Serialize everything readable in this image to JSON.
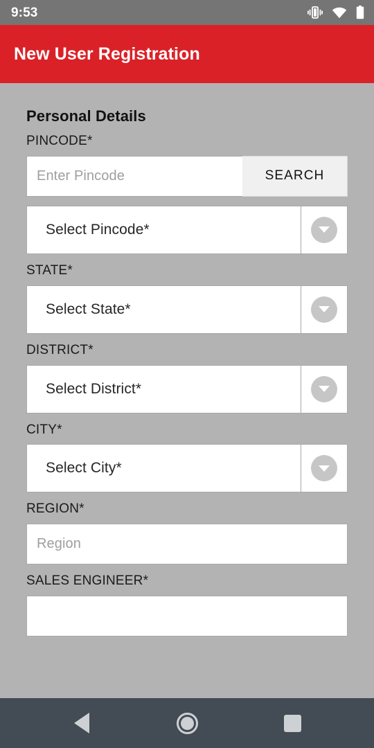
{
  "status_bar": {
    "time": "9:53",
    "icons": [
      "vibrate-icon",
      "wifi-icon",
      "battery-icon"
    ]
  },
  "app_bar": {
    "title": "New User Registration",
    "background_color": "#da2128",
    "text_color": "#ffffff"
  },
  "theme": {
    "page_background": "#b3b3b3",
    "field_background": "#ffffff",
    "field_border": "#a8a8a8",
    "status_bar_background": "#757575",
    "nav_bar_background": "#434b54",
    "nav_icon_color": "#cdd1d4",
    "dropdown_circle_color": "#c6c6c6",
    "search_button_background": "#f0f0f0",
    "placeholder_color": "#9e9e9e"
  },
  "form": {
    "section_title": "Personal Details",
    "fields": [
      {
        "key": "pincode",
        "label": "PINCODE*",
        "type": "text-with-button",
        "placeholder": "Enter Pincode",
        "value": "",
        "button_label": "SEARCH"
      },
      {
        "key": "select_pincode",
        "label": "",
        "type": "dropdown",
        "selected": "Select Pincode*"
      },
      {
        "key": "state",
        "label": "STATE*",
        "type": "dropdown",
        "selected": "Select State*"
      },
      {
        "key": "district",
        "label": "DISTRICT*",
        "type": "dropdown",
        "selected": "Select District*"
      },
      {
        "key": "city",
        "label": "CITY*",
        "type": "dropdown",
        "selected": "Select City*"
      },
      {
        "key": "region",
        "label": "REGION*",
        "type": "text",
        "placeholder": "Region",
        "value": ""
      },
      {
        "key": "sales_engineer",
        "label": "SALES ENGINEER*",
        "type": "text",
        "placeholder": "",
        "value": ""
      }
    ]
  },
  "nav_bar": {
    "buttons": [
      {
        "name": "back",
        "icon": "back-triangle-icon"
      },
      {
        "name": "home",
        "icon": "home-circle-icon"
      },
      {
        "name": "recents",
        "icon": "recents-square-icon"
      }
    ]
  }
}
